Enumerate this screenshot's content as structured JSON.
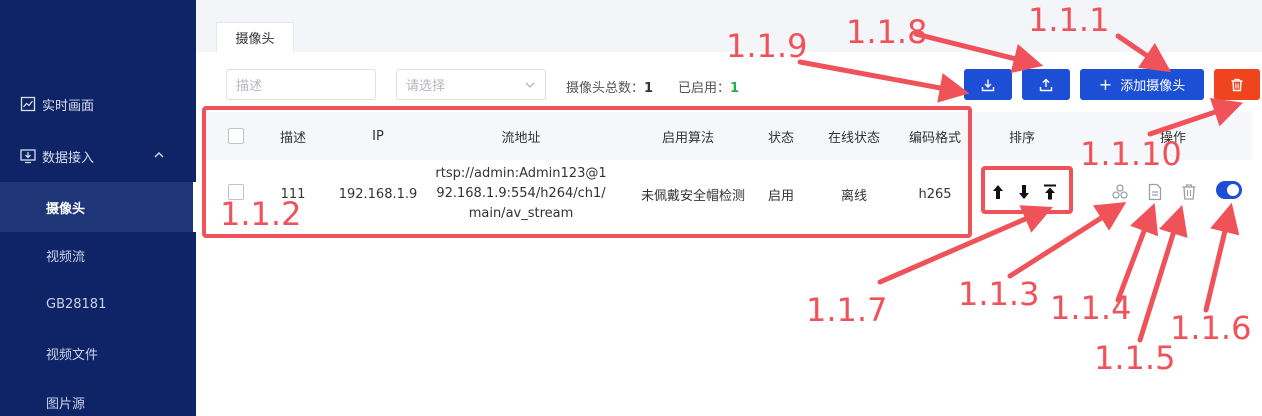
{
  "sidebar": {
    "items": [
      {
        "label": "实时画面",
        "icon": "chart-icon"
      },
      {
        "label": "数据接入",
        "icon": "monitor-download-icon"
      }
    ],
    "subitems": [
      {
        "label": "摄像头",
        "active": true
      },
      {
        "label": "视频流"
      },
      {
        "label": "GB28181"
      },
      {
        "label": "视频文件"
      },
      {
        "label": "图片源"
      }
    ]
  },
  "tab": {
    "label": "摄像头"
  },
  "filters": {
    "description_placeholder": "描述",
    "select_placeholder": "请选择"
  },
  "stats": {
    "total_label": "摄像头总数：",
    "total_value": "1",
    "enabled_label": "已启用：",
    "enabled_value": "1"
  },
  "toolbar": {
    "add_camera_label": "添加摄像头"
  },
  "table": {
    "headers": [
      "描述",
      "IP",
      "流地址",
      "启用算法",
      "状态",
      "在线状态",
      "编码格式",
      "排序",
      "操作"
    ],
    "rows": [
      {
        "description": "111",
        "ip": "192.168.1.9",
        "stream_url": "rtsp://admin:Admin123@192.168.1.9:554/h264/ch1/main/av_stream",
        "algorithm": "未佩戴安全帽检测",
        "status": "启用",
        "online_status": "离线",
        "encoding": "h265",
        "enabled": true
      }
    ]
  },
  "annotations": {
    "table_box": "1.1.2",
    "add_camera": "1.1.1",
    "upload": "1.1.8",
    "download": "1.1.9",
    "delete_all": "1.1.10",
    "sort": "1.1.7",
    "algorithm_op": "1.1.3",
    "edit_op": "1.1.4",
    "delete_op": "1.1.5",
    "toggle_op": "1.1.6"
  },
  "colors": {
    "sidebar_bg": "#0f2466",
    "primary": "#1c4fd6",
    "danger": "#f0441e",
    "annotation": "#f0525a",
    "enabled_count": "#28b148"
  }
}
